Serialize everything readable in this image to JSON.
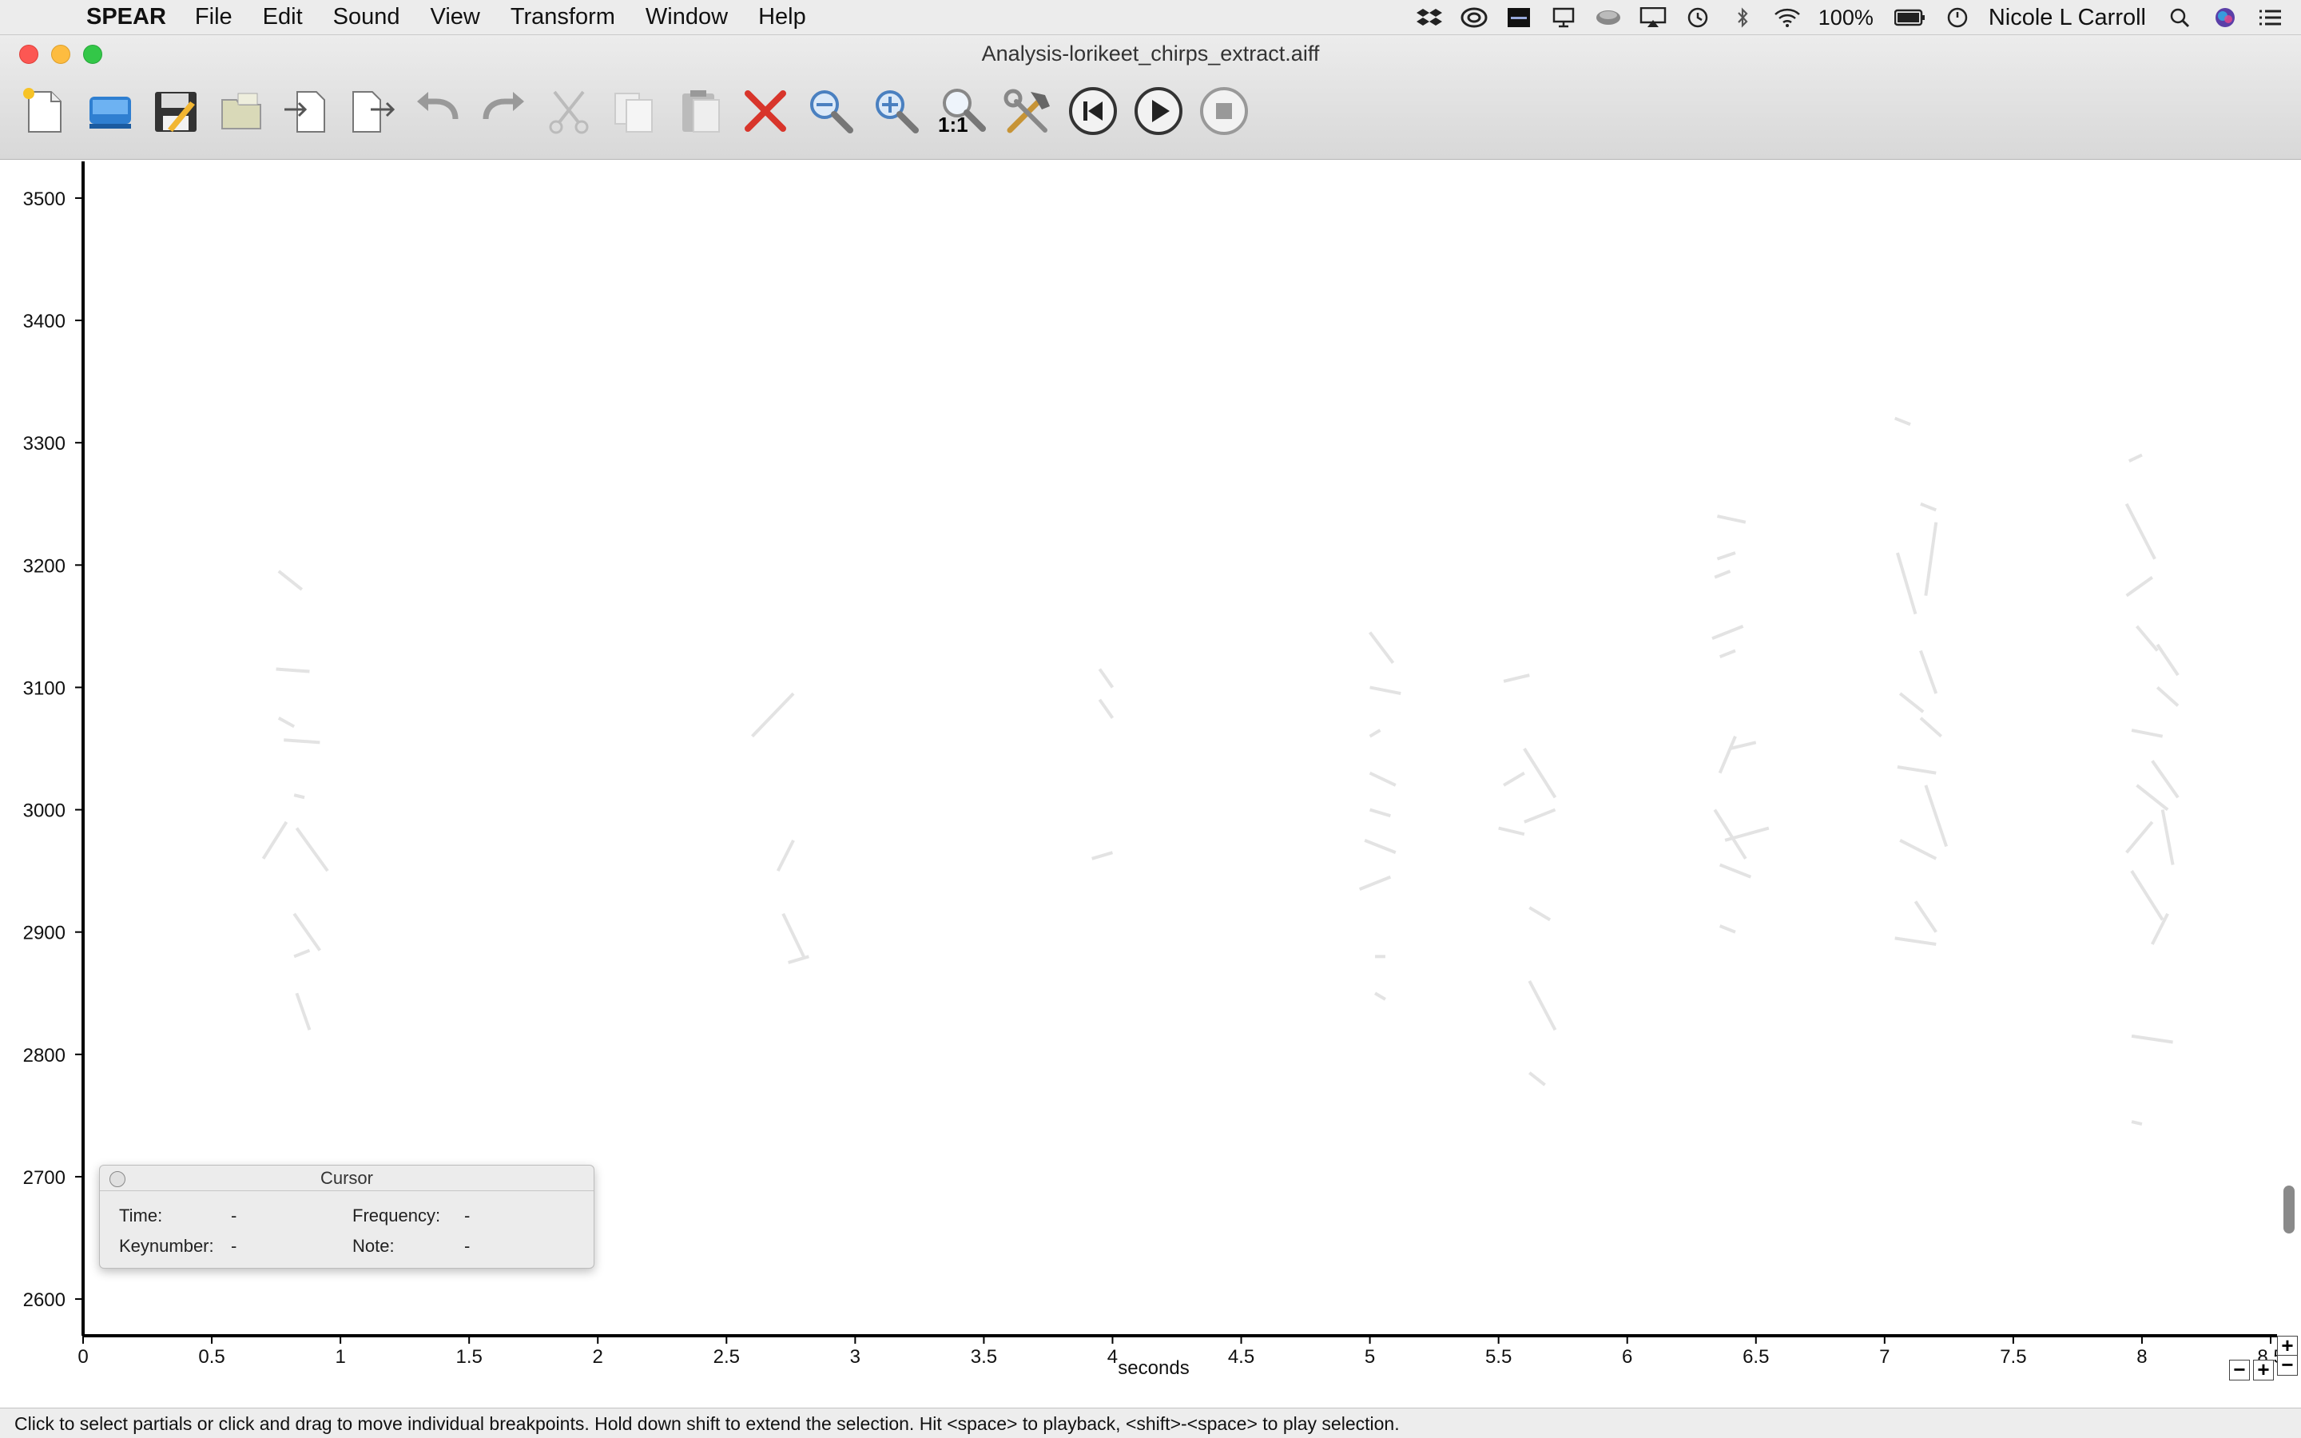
{
  "menubar": {
    "app": "SPEAR",
    "items": [
      "File",
      "Edit",
      "Sound",
      "View",
      "Transform",
      "Window",
      "Help"
    ],
    "battery": "100%",
    "user": "Nicole L Carroll"
  },
  "window": {
    "title": "Analysis-lorikeet_chirps_extract.aiff",
    "toolbar": [
      "new-document",
      "open",
      "save",
      "save-as",
      "import",
      "export",
      "undo",
      "redo",
      "cut",
      "copy",
      "paste",
      "delete",
      "zoom-out",
      "zoom-in",
      "zoom-1-1",
      "tools",
      "rewind",
      "play",
      "stop"
    ],
    "zoom_label": "1:1"
  },
  "chart_data": {
    "type": "scatter",
    "xlabel": "seconds",
    "ylabel": "",
    "xlim": [
      0,
      8.5
    ],
    "ylim": [
      2570,
      3530
    ],
    "x_ticks": [
      "0",
      "0.5",
      "1",
      "1.5",
      "2",
      "2.5",
      "3",
      "3.5",
      "4",
      "4.5",
      "5",
      "5.5",
      "6",
      "6.5",
      "7",
      "7.5",
      "8",
      "8.5"
    ],
    "y_ticks": [
      "3500",
      "3400",
      "3300",
      "3200",
      "3100",
      "3000",
      "2900",
      "2800",
      "2700",
      "2600"
    ],
    "partials": [
      [
        [
          0.76,
          3195
        ],
        [
          0.85,
          3180
        ]
      ],
      [
        [
          0.75,
          3115
        ],
        [
          0.88,
          3113
        ]
      ],
      [
        [
          0.76,
          3075
        ],
        [
          0.82,
          3068
        ]
      ],
      [
        [
          0.78,
          3057
        ],
        [
          0.92,
          3055
        ]
      ],
      [
        [
          0.82,
          3012
        ],
        [
          0.86,
          3010
        ]
      ],
      [
        [
          0.83,
          2985
        ],
        [
          0.95,
          2950
        ]
      ],
      [
        [
          0.7,
          2960
        ],
        [
          0.79,
          2990
        ]
      ],
      [
        [
          0.82,
          2915
        ],
        [
          0.92,
          2885
        ]
      ],
      [
        [
          0.82,
          2880
        ],
        [
          0.88,
          2885
        ]
      ],
      [
        [
          0.83,
          2850
        ],
        [
          0.88,
          2820
        ]
      ],
      [
        [
          2.6,
          3060
        ],
        [
          2.76,
          3095
        ]
      ],
      [
        [
          2.7,
          2950
        ],
        [
          2.76,
          2975
        ]
      ],
      [
        [
          2.72,
          2915
        ],
        [
          2.8,
          2880
        ]
      ],
      [
        [
          2.74,
          2875
        ],
        [
          2.82,
          2880
        ]
      ],
      [
        [
          3.95,
          3115
        ],
        [
          4.0,
          3100
        ]
      ],
      [
        [
          3.95,
          3090
        ],
        [
          4.0,
          3075
        ]
      ],
      [
        [
          3.92,
          2960
        ],
        [
          4.0,
          2965
        ]
      ],
      [
        [
          5.0,
          3145
        ],
        [
          5.09,
          3120
        ]
      ],
      [
        [
          5.0,
          3100
        ],
        [
          5.12,
          3095
        ]
      ],
      [
        [
          5.0,
          3060
        ],
        [
          5.04,
          3065
        ]
      ],
      [
        [
          5.0,
          3030
        ],
        [
          5.1,
          3020
        ]
      ],
      [
        [
          5.0,
          3000
        ],
        [
          5.08,
          2995
        ]
      ],
      [
        [
          4.98,
          2975
        ],
        [
          5.1,
          2965
        ]
      ],
      [
        [
          4.96,
          2935
        ],
        [
          5.08,
          2945
        ]
      ],
      [
        [
          5.02,
          2880
        ],
        [
          5.06,
          2880
        ]
      ],
      [
        [
          5.02,
          2850
        ],
        [
          5.06,
          2845
        ]
      ],
      [
        [
          5.52,
          3105
        ],
        [
          5.62,
          3110
        ]
      ],
      [
        [
          5.52,
          3020
        ],
        [
          5.6,
          3030
        ]
      ],
      [
        [
          5.6,
          3050
        ],
        [
          5.72,
          3010
        ]
      ],
      [
        [
          5.5,
          2985
        ],
        [
          5.6,
          2980
        ]
      ],
      [
        [
          5.6,
          2990
        ],
        [
          5.72,
          3000
        ]
      ],
      [
        [
          5.62,
          2920
        ],
        [
          5.7,
          2910
        ]
      ],
      [
        [
          5.62,
          2860
        ],
        [
          5.72,
          2820
        ]
      ],
      [
        [
          5.62,
          2785
        ],
        [
          5.68,
          2775
        ]
      ],
      [
        [
          6.35,
          3240
        ],
        [
          6.46,
          3235
        ]
      ],
      [
        [
          6.35,
          3205
        ],
        [
          6.42,
          3210
        ]
      ],
      [
        [
          6.34,
          3190
        ],
        [
          6.4,
          3195
        ]
      ],
      [
        [
          6.33,
          3140
        ],
        [
          6.45,
          3150
        ]
      ],
      [
        [
          6.36,
          3125
        ],
        [
          6.42,
          3130
        ]
      ],
      [
        [
          6.4,
          3050
        ],
        [
          6.5,
          3055
        ]
      ],
      [
        [
          6.36,
          3030
        ],
        [
          6.42,
          3060
        ]
      ],
      [
        [
          6.34,
          3000
        ],
        [
          6.46,
          2960
        ]
      ],
      [
        [
          6.38,
          2975
        ],
        [
          6.55,
          2985
        ]
      ],
      [
        [
          6.36,
          2955
        ],
        [
          6.48,
          2945
        ]
      ],
      [
        [
          6.36,
          2905
        ],
        [
          6.42,
          2900
        ]
      ],
      [
        [
          7.04,
          3320
        ],
        [
          7.1,
          3315
        ]
      ],
      [
        [
          7.14,
          3250
        ],
        [
          7.2,
          3245
        ]
      ],
      [
        [
          7.2,
          3235
        ],
        [
          7.16,
          3175
        ]
      ],
      [
        [
          7.05,
          3210
        ],
        [
          7.12,
          3160
        ]
      ],
      [
        [
          7.14,
          3130
        ],
        [
          7.2,
          3095
        ]
      ],
      [
        [
          7.06,
          3095
        ],
        [
          7.15,
          3080
        ]
      ],
      [
        [
          7.14,
          3075
        ],
        [
          7.22,
          3060
        ]
      ],
      [
        [
          7.05,
          3035
        ],
        [
          7.2,
          3030
        ]
      ],
      [
        [
          7.16,
          3020
        ],
        [
          7.24,
          2970
        ]
      ],
      [
        [
          7.06,
          2975
        ],
        [
          7.2,
          2960
        ]
      ],
      [
        [
          7.12,
          2925
        ],
        [
          7.2,
          2900
        ]
      ],
      [
        [
          7.04,
          2895
        ],
        [
          7.2,
          2890
        ]
      ],
      [
        [
          7.95,
          3285
        ],
        [
          8.0,
          3290
        ]
      ],
      [
        [
          7.94,
          3250
        ],
        [
          8.05,
          3205
        ]
      ],
      [
        [
          7.94,
          3175
        ],
        [
          8.04,
          3190
        ]
      ],
      [
        [
          7.98,
          3150
        ],
        [
          8.06,
          3130
        ]
      ],
      [
        [
          8.06,
          3135
        ],
        [
          8.14,
          3110
        ]
      ],
      [
        [
          8.06,
          3100
        ],
        [
          8.14,
          3085
        ]
      ],
      [
        [
          7.96,
          3065
        ],
        [
          8.08,
          3060
        ]
      ],
      [
        [
          8.04,
          3040
        ],
        [
          8.14,
          3010
        ]
      ],
      [
        [
          7.98,
          3020
        ],
        [
          8.1,
          3000
        ]
      ],
      [
        [
          7.94,
          2965
        ],
        [
          8.04,
          2990
        ]
      ],
      [
        [
          8.08,
          3000
        ],
        [
          8.12,
          2955
        ]
      ],
      [
        [
          7.96,
          2950
        ],
        [
          8.08,
          2910
        ]
      ],
      [
        [
          8.04,
          2890
        ],
        [
          8.1,
          2915
        ]
      ],
      [
        [
          7.96,
          2815
        ],
        [
          8.12,
          2810
        ]
      ],
      [
        [
          7.96,
          2745
        ],
        [
          8.0,
          2743
        ]
      ]
    ]
  },
  "cursor_panel": {
    "title": "Cursor",
    "time_label": "Time:",
    "time_value": "-",
    "frequency_label": "Frequency:",
    "frequency_value": "-",
    "keynumber_label": "Keynumber:",
    "keynumber_value": "-",
    "note_label": "Note:",
    "note_value": "-"
  },
  "status": "Click to select partials or click and drag to move individual breakpoints. Hold down shift to extend the selection. Hit <space> to playback, <shift>-<space> to play selection."
}
